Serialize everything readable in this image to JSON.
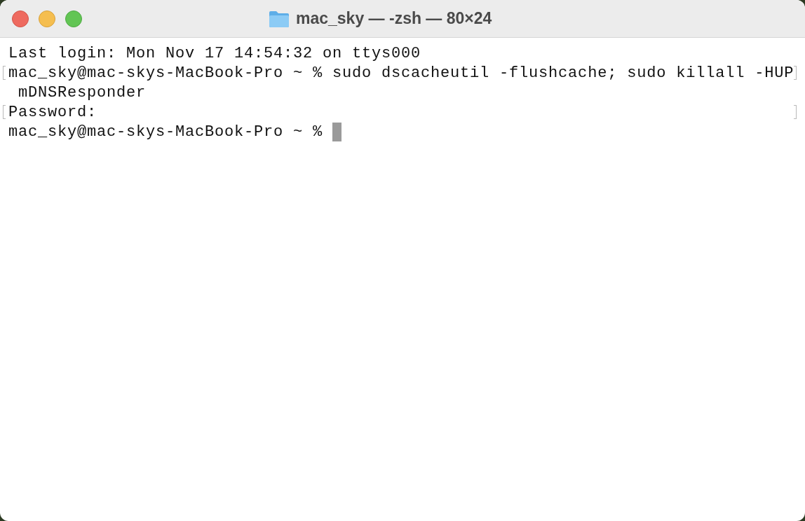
{
  "window": {
    "title": "mac_sky — -zsh — 80×24",
    "controls": [
      {
        "kind": "close"
      },
      {
        "kind": "minimize"
      },
      {
        "kind": "zoom"
      }
    ]
  },
  "terminal": {
    "lines": [
      {
        "text": "Last login: Mon Nov 17 14:54:32 on ttys000",
        "marked": false
      },
      {
        "text": "mac_sky@mac-skys-MacBook-Pro ~ % sudo dscacheutil -flushcache; sudo killall -HUP",
        "marked": true
      },
      {
        "text": " mDNSResponder",
        "marked": false
      },
      {
        "text": "Password:",
        "marked": true
      },
      {
        "text": "mac_sky@mac-skys-MacBook-Pro ~ %",
        "marked": false
      }
    ],
    "cursor_visible": true
  }
}
